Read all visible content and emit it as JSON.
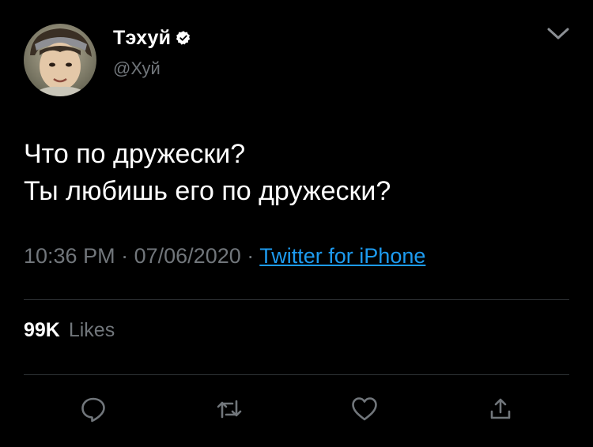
{
  "user": {
    "display_name": "Тэхуй",
    "handle": "@Хуй",
    "verified": true
  },
  "tweet": {
    "lines": [
      "Что по дружески?",
      "Ты любишь его по дружески?"
    ]
  },
  "meta": {
    "time": "10:36 PM",
    "separator": "·",
    "date": "07/06/2020",
    "source": "Twitter for iPhone"
  },
  "stats": {
    "likes_count": "99K",
    "likes_label": "Likes"
  },
  "icons": {
    "more": "chevron-down-icon",
    "reply": "reply-icon",
    "retweet": "retweet-icon",
    "like": "heart-icon",
    "share": "share-icon",
    "verified": "verified-badge-icon"
  },
  "colors": {
    "background": "#000000",
    "text": "#ffffff",
    "muted": "#71767b",
    "link": "#1d9bf0",
    "divider": "#2f3336"
  }
}
